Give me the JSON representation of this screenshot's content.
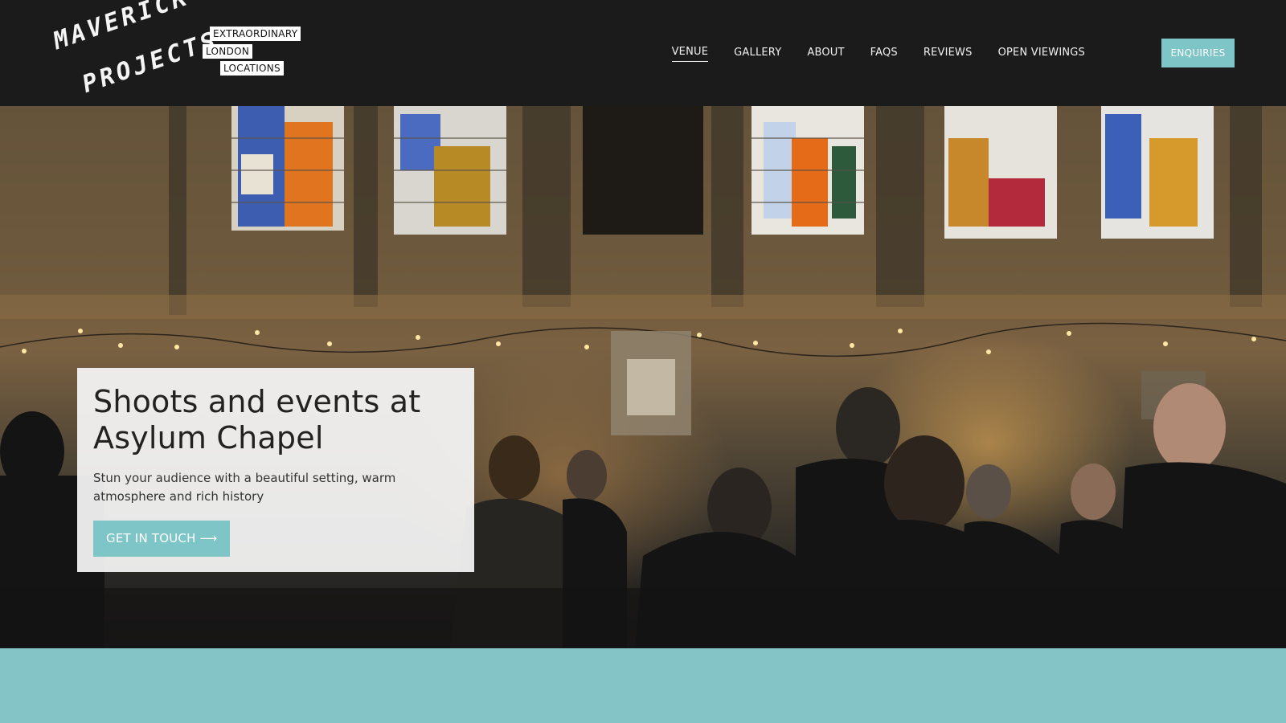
{
  "brand": {
    "logo_line1": "MAVERICK",
    "logo_line2": "PROJECTS",
    "tagline": [
      "EXTRAORDINARY",
      "LONDON",
      "LOCATIONS"
    ]
  },
  "nav": {
    "items": [
      {
        "label": "VENUE",
        "active": true
      },
      {
        "label": "GALLERY",
        "active": false
      },
      {
        "label": "ABOUT",
        "active": false
      },
      {
        "label": "FAQS",
        "active": false
      },
      {
        "label": "REVIEWS",
        "active": false
      },
      {
        "label": "OPEN VIEWINGS",
        "active": false
      }
    ],
    "enquiries_label": "ENQUIRIES"
  },
  "hero": {
    "title_line1": "Shoots and events at",
    "title_line2": "Asylum Chapel",
    "subtitle": "Stun your audience with a beautiful setting, warm atmosphere and rich history",
    "cta_label": "GET IN TOUCH ⟶"
  },
  "colors": {
    "header_bg": "#1b1b1b",
    "accent_teal": "#7ec5c8",
    "band_teal": "#84c4c6",
    "card_bg": "#f6f6f6"
  }
}
